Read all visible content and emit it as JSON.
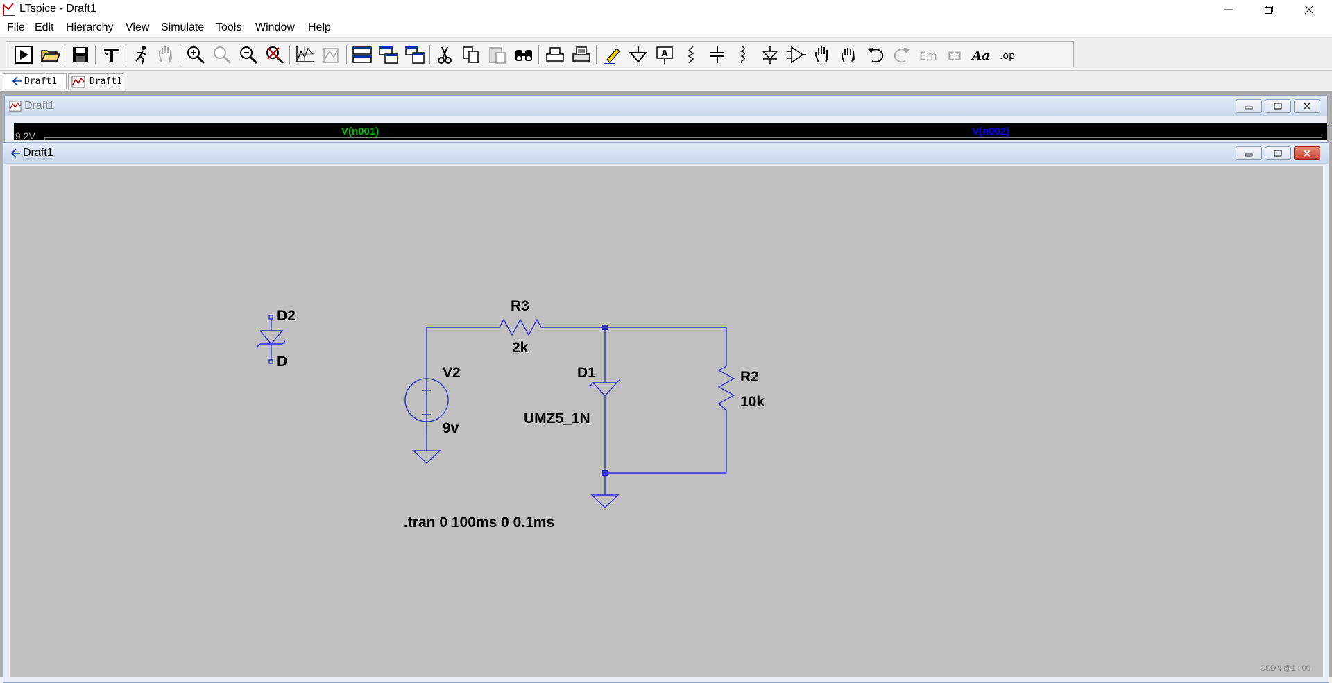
{
  "window": {
    "title": "LTspice - Draft1"
  },
  "menu": [
    "File",
    "Edit",
    "Hierarchy",
    "View",
    "Simulate",
    "Tools",
    "Window",
    "Help"
  ],
  "toolbar": {
    "buttons": [
      "run-icon",
      "open-icon",
      "save-icon",
      "control-panel-icon",
      "run-halt-icon",
      "pan-icon",
      "zoom-in-icon",
      "zoom-area-icon",
      "zoom-out-icon",
      "zoom-fit-icon",
      "autoscale-icon",
      "plot-settings-icon",
      "tile-horizontal-icon",
      "cascade-icon",
      "tile-vertical-icon",
      "cut-icon",
      "copy-icon",
      "paste-icon",
      "find-icon",
      "print-setup-icon",
      "print-icon",
      "draw-wire-icon",
      "ground-icon",
      "label-net-icon",
      "resistor-icon",
      "capacitor-icon",
      "inductor-icon",
      "diode-icon",
      "component-icon",
      "move-icon",
      "drag-icon",
      "undo-icon",
      "redo-icon",
      "rotate-icon",
      "mirror-icon",
      "text-icon",
      "spice-directive-icon"
    ]
  },
  "tabs": [
    {
      "label": "Draft1",
      "icon": "schematic-icon"
    },
    {
      "label": "Draft1",
      "icon": "waveform-icon"
    }
  ],
  "waveform_window": {
    "title": "Draft1",
    "y_tick": "9.2V",
    "traces": [
      {
        "name": "V(n001)",
        "color": "#00c000"
      },
      {
        "name": "V(n002)",
        "color": "#0000ff"
      }
    ]
  },
  "schematic_window": {
    "title": "Draft1",
    "wire_color": "#3030c8",
    "components": {
      "D2": {
        "name": "D2",
        "value": "D"
      },
      "V2": {
        "name": "V2",
        "value": "9v"
      },
      "R3": {
        "name": "R3",
        "value": "2k"
      },
      "D1": {
        "name": "D1",
        "value": "UMZ5_1N"
      },
      "R2": {
        "name": "R2",
        "value": "10k"
      }
    },
    "directive": ".tran 0 100ms 0 0.1ms"
  },
  "watermark": "CSDN @1 : 00"
}
